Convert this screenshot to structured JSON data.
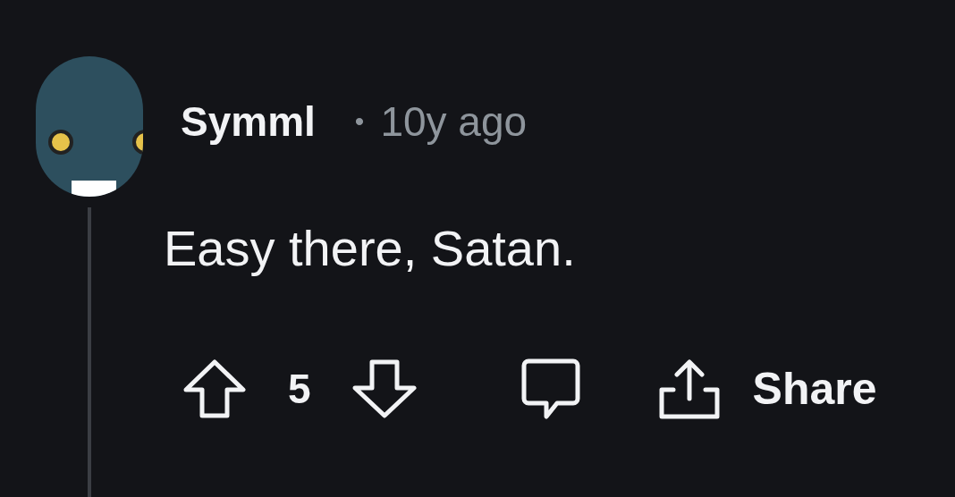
{
  "comment": {
    "author": "Symml",
    "separator": "•",
    "time": "10y ago",
    "text": "Easy there, Satan.",
    "score": "5",
    "share_label": "Share"
  }
}
